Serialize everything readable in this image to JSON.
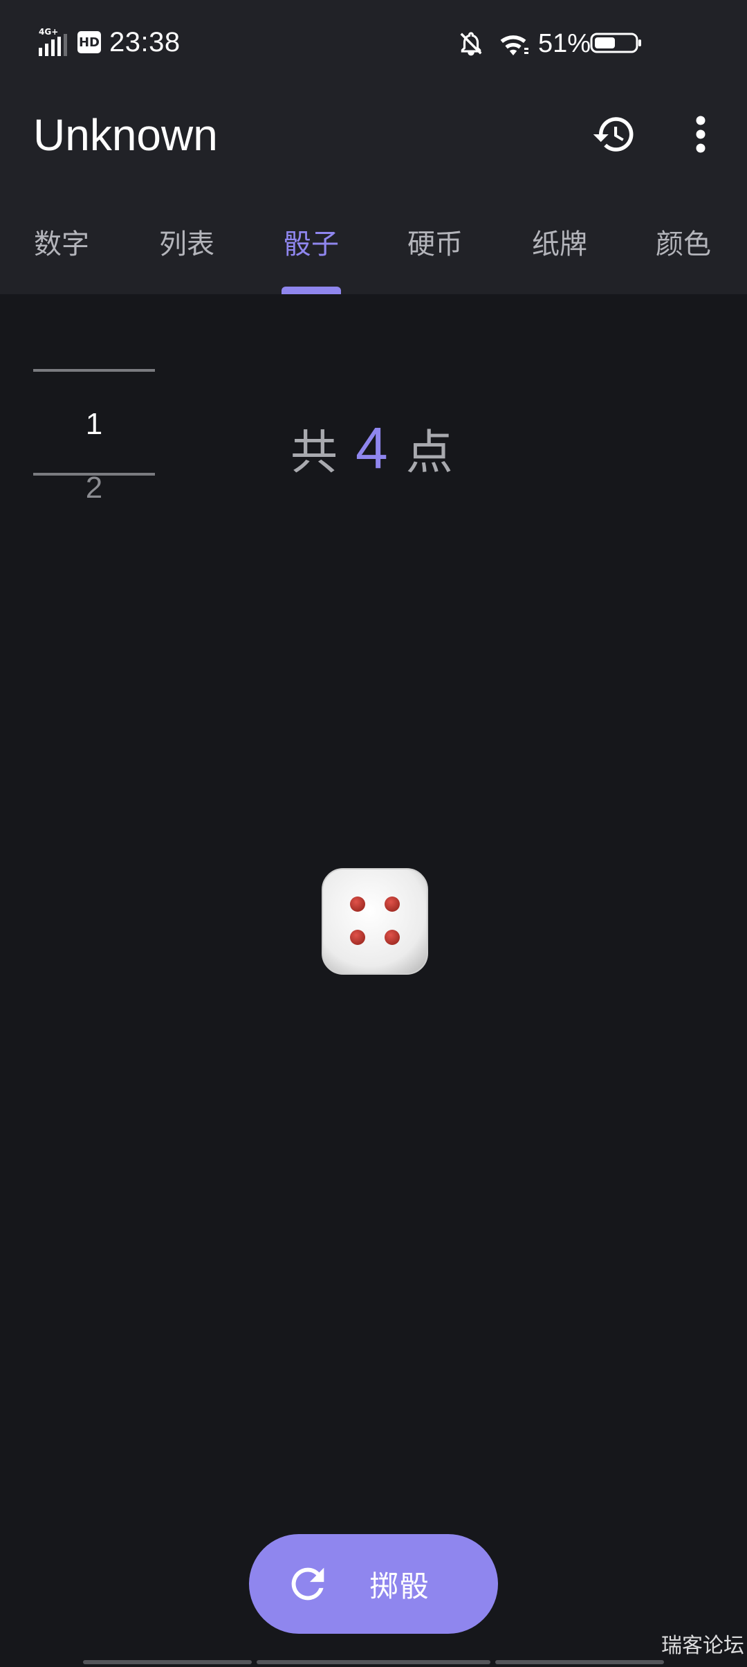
{
  "status_bar": {
    "network": "4G+",
    "hd_badge": "HD",
    "time": "23:38",
    "battery_percent": "51%",
    "battery_level": 0.51,
    "icons": [
      "signal-icon",
      "bell-off-icon",
      "wifi-icon",
      "battery-icon"
    ]
  },
  "app_bar": {
    "title": "Unknown",
    "actions": [
      "history-icon",
      "more-vert-icon"
    ]
  },
  "tabs": [
    {
      "label": "数字",
      "active": false
    },
    {
      "label": "列表",
      "active": false
    },
    {
      "label": "骰子",
      "active": true
    },
    {
      "label": "硬币",
      "active": false
    },
    {
      "label": "纸牌",
      "active": false
    },
    {
      "label": "颜色",
      "active": false
    }
  ],
  "picker": {
    "current": "1",
    "next": "2"
  },
  "total": {
    "prefix": "共",
    "value": "4",
    "suffix": "点"
  },
  "die": {
    "face": 4,
    "pip_color": "#c0392b",
    "face_color": "#f2f2f2"
  },
  "roll_button": {
    "label": "掷骰",
    "icon": "refresh-icon"
  },
  "watermark": "瑞客论坛",
  "colors": {
    "accent": "#8f86ee",
    "background": "#16171b",
    "surface": "#212227"
  }
}
